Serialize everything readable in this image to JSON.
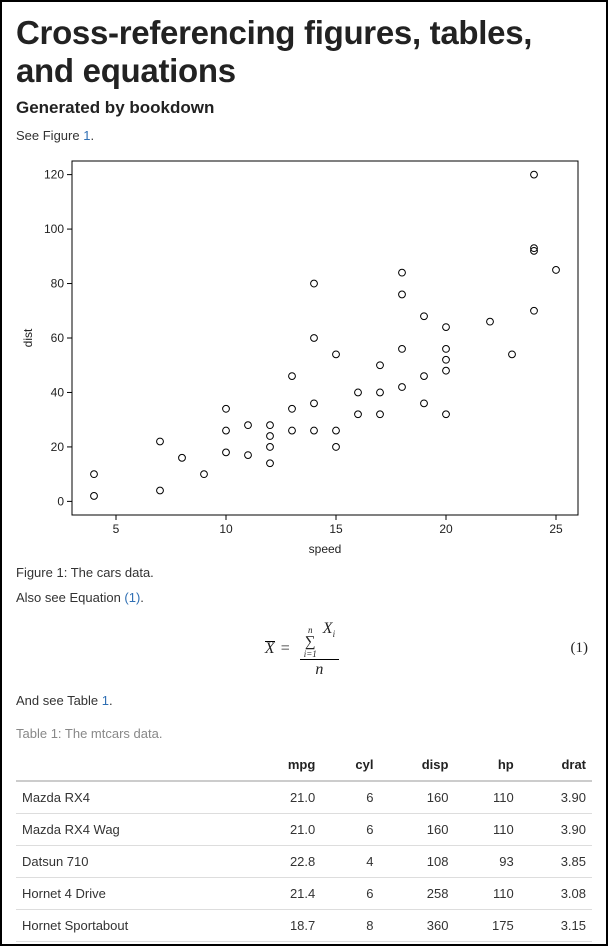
{
  "title": "Cross-referencing figures, tables, and equations",
  "subtitle": "Generated by bookdown",
  "p1_prefix": "See Figure ",
  "p1_link": "1",
  "p1_suffix": ".",
  "fig_caption_prefix": "Figure 1",
  "fig_caption_rest": ": The cars data.",
  "p2_prefix": "Also see Equation ",
  "p2_link": "(1)",
  "p2_suffix": ".",
  "eq": {
    "lhs_var": "X",
    "eq_sign": "=",
    "sum_upper": "n",
    "sum_lower": "i=1",
    "num_var": "X",
    "num_sub": "i",
    "den": "n",
    "number": "(1)"
  },
  "p3_prefix": "And see Table ",
  "p3_link": "1",
  "p3_suffix": ".",
  "tbl_caption_prefix": "Table 1",
  "tbl_caption_rest": ": The mtcars data.",
  "table": {
    "headers": [
      "",
      "mpg",
      "cyl",
      "disp",
      "hp",
      "drat"
    ],
    "rows": [
      [
        "Mazda RX4",
        "21.0",
        "6",
        "160",
        "110",
        "3.90"
      ],
      [
        "Mazda RX4 Wag",
        "21.0",
        "6",
        "160",
        "110",
        "3.90"
      ],
      [
        "Datsun 710",
        "22.8",
        "4",
        "108",
        "93",
        "3.85"
      ],
      [
        "Hornet 4 Drive",
        "21.4",
        "6",
        "258",
        "110",
        "3.08"
      ],
      [
        "Hornet Sportabout",
        "18.7",
        "8",
        "360",
        "175",
        "3.15"
      ]
    ]
  },
  "chart_data": {
    "type": "scatter",
    "xlabel": "speed",
    "ylabel": "dist",
    "xlim": [
      3,
      26
    ],
    "ylim": [
      -5,
      125
    ],
    "x_ticks": [
      5,
      10,
      15,
      20,
      25
    ],
    "y_ticks": [
      0,
      20,
      40,
      60,
      80,
      100,
      120
    ],
    "points": [
      {
        "x": 4,
        "y": 2
      },
      {
        "x": 4,
        "y": 10
      },
      {
        "x": 7,
        "y": 4
      },
      {
        "x": 7,
        "y": 22
      },
      {
        "x": 8,
        "y": 16
      },
      {
        "x": 9,
        "y": 10
      },
      {
        "x": 10,
        "y": 18
      },
      {
        "x": 10,
        "y": 26
      },
      {
        "x": 10,
        "y": 34
      },
      {
        "x": 11,
        "y": 17
      },
      {
        "x": 11,
        "y": 28
      },
      {
        "x": 12,
        "y": 14
      },
      {
        "x": 12,
        "y": 20
      },
      {
        "x": 12,
        "y": 24
      },
      {
        "x": 12,
        "y": 28
      },
      {
        "x": 13,
        "y": 26
      },
      {
        "x": 13,
        "y": 34
      },
      {
        "x": 13,
        "y": 46
      },
      {
        "x": 14,
        "y": 26
      },
      {
        "x": 14,
        "y": 36
      },
      {
        "x": 14,
        "y": 60
      },
      {
        "x": 14,
        "y": 80
      },
      {
        "x": 15,
        "y": 20
      },
      {
        "x": 15,
        "y": 26
      },
      {
        "x": 15,
        "y": 54
      },
      {
        "x": 16,
        "y": 32
      },
      {
        "x": 16,
        "y": 40
      },
      {
        "x": 17,
        "y": 32
      },
      {
        "x": 17,
        "y": 40
      },
      {
        "x": 17,
        "y": 50
      },
      {
        "x": 18,
        "y": 42
      },
      {
        "x": 18,
        "y": 56
      },
      {
        "x": 18,
        "y": 76
      },
      {
        "x": 18,
        "y": 84
      },
      {
        "x": 19,
        "y": 36
      },
      {
        "x": 19,
        "y": 46
      },
      {
        "x": 19,
        "y": 68
      },
      {
        "x": 20,
        "y": 32
      },
      {
        "x": 20,
        "y": 48
      },
      {
        "x": 20,
        "y": 52
      },
      {
        "x": 20,
        "y": 56
      },
      {
        "x": 20,
        "y": 64
      },
      {
        "x": 22,
        "y": 66
      },
      {
        "x": 23,
        "y": 54
      },
      {
        "x": 24,
        "y": 70
      },
      {
        "x": 24,
        "y": 92
      },
      {
        "x": 24,
        "y": 93
      },
      {
        "x": 24,
        "y": 120
      },
      {
        "x": 25,
        "y": 85
      }
    ]
  }
}
